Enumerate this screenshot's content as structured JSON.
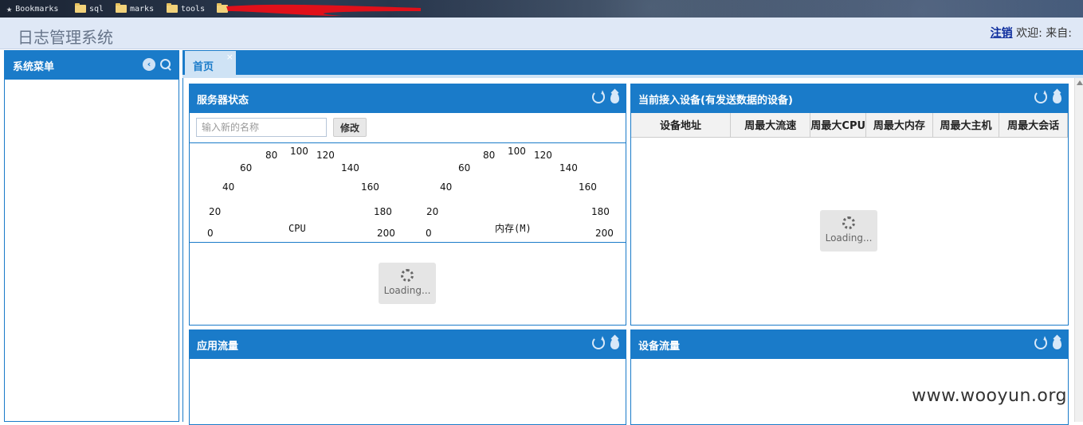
{
  "browser": {
    "bookmarks": [
      {
        "label": "Bookmarks",
        "icon": "star-icon"
      },
      {
        "label": "sql",
        "icon": "folder-icon"
      },
      {
        "label": "marks",
        "icon": "folder-icon"
      },
      {
        "label": "tools",
        "icon": "folder-icon"
      }
    ]
  },
  "header": {
    "title": "日志管理系统",
    "logout": "注销",
    "welcome": "欢迎: 来自:"
  },
  "sidebar": {
    "title": "系统菜单"
  },
  "tabs": [
    {
      "label": "首页",
      "close": "×"
    }
  ],
  "panels": {
    "server_status": {
      "title": "服务器状态",
      "name_placeholder": "输入新的名称",
      "edit_button": "修改",
      "gauges": [
        {
          "title": "CPU",
          "ticks": [
            "0",
            "20",
            "40",
            "60",
            "80",
            "100",
            "120",
            "140",
            "160",
            "180",
            "200"
          ]
        },
        {
          "title": "内存(M)",
          "ticks": [
            "0",
            "20",
            "40",
            "60",
            "80",
            "100",
            "120",
            "140",
            "160",
            "180",
            "200"
          ]
        }
      ],
      "loading": "Loading..."
    },
    "devices": {
      "title": "当前接入设备(有发送数据的设备)",
      "columns": [
        "设备地址",
        "周最大流速",
        "周最大CPU",
        "周最大内存",
        "周最大主机",
        "周最大会话"
      ],
      "loading": "Loading..."
    },
    "app_traffic": {
      "title": "应用流量"
    },
    "device_traffic": {
      "title": "设备流量"
    }
  },
  "watermark": "www.wooyun.org",
  "colors": {
    "accent": "#1a7bc9",
    "header_bg": "#dfe8f6",
    "tab_bg": "#cfe3f5"
  }
}
